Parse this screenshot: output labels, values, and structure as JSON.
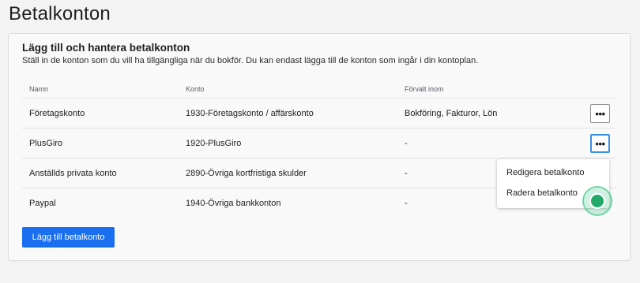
{
  "page": {
    "title": "Betalkonton"
  },
  "card": {
    "heading": "Lägg till och hantera betalkonton",
    "description": "Ställ in de konton som du vill ha tillgängliga när du bokför. Du kan endast lägga till de konton som ingår i din kontoplan."
  },
  "table": {
    "headers": {
      "name": "Namn",
      "account": "Konto",
      "default": "Förvalt inom"
    },
    "rows": [
      {
        "name": "Företagskonto",
        "account": "1930-Företagskonto / affärskonto",
        "default": "Bokföring, Fakturor, Lön",
        "actions_icon": "more-dots-icon"
      },
      {
        "name": "PlusGiro",
        "account": "1920-PlusGiro",
        "default": "-",
        "actions_icon": "more-dots-icon"
      },
      {
        "name": "Anställds privata konto",
        "account": "2890-Övriga kortfristiga skulder",
        "default": "-"
      },
      {
        "name": "Paypal",
        "account": "1940-Övriga bankkonton",
        "default": "-"
      }
    ]
  },
  "actions": {
    "add_label": "Lägg till betalkonto",
    "more_glyph": "•••"
  },
  "dropdown_menu": {
    "items": [
      "Redigera betalkonto",
      "Radera betalkonto"
    ]
  },
  "colors": {
    "primary_button": "#1a6ef0",
    "focus_border": "#3a8ee8",
    "cursor_indicator": "#24a86a"
  }
}
